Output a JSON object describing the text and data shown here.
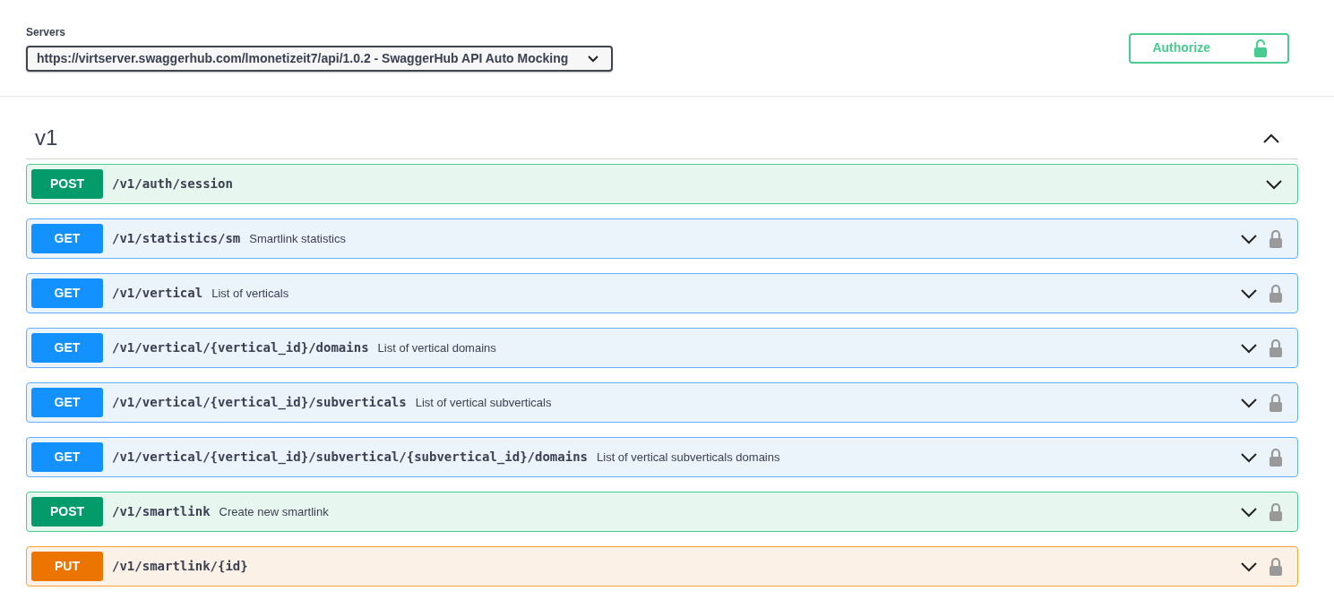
{
  "servers": {
    "label": "Servers",
    "selected": "https://virtserver.swaggerhub.com/lmonetizeit7/api/1.0.2 - SwaggerHub API Auto Mocking"
  },
  "authorize": {
    "label": "Authorize"
  },
  "section": {
    "title": "v1",
    "expanded": true
  },
  "operations": [
    {
      "method": "POST",
      "path": "/v1/auth/session",
      "secured": false
    },
    {
      "method": "GET",
      "path": "/v1/statistics/sm",
      "summary": "Smartlink statistics",
      "secured": true
    },
    {
      "method": "GET",
      "path": "/v1/vertical",
      "summary": "List of verticals",
      "secured": true
    },
    {
      "method": "GET",
      "path": "/v1/vertical/{vertical_id}/domains",
      "summary": "List of vertical domains",
      "secured": true
    },
    {
      "method": "GET",
      "path": "/v1/vertical/{vertical_id}/subverticals",
      "summary": "List of vertical subverticals",
      "secured": true
    },
    {
      "method": "GET",
      "path": "/v1/vertical/{vertical_id}/subvertical/{subvertical_id}/domains",
      "summary": "List of vertical subverticals domains",
      "secured": true
    },
    {
      "method": "POST",
      "path": "/v1/smartlink",
      "summary": "Create new smartlink",
      "secured": true
    },
    {
      "method": "PUT",
      "path": "/v1/smartlink/{id}",
      "secured": true
    }
  ]
}
